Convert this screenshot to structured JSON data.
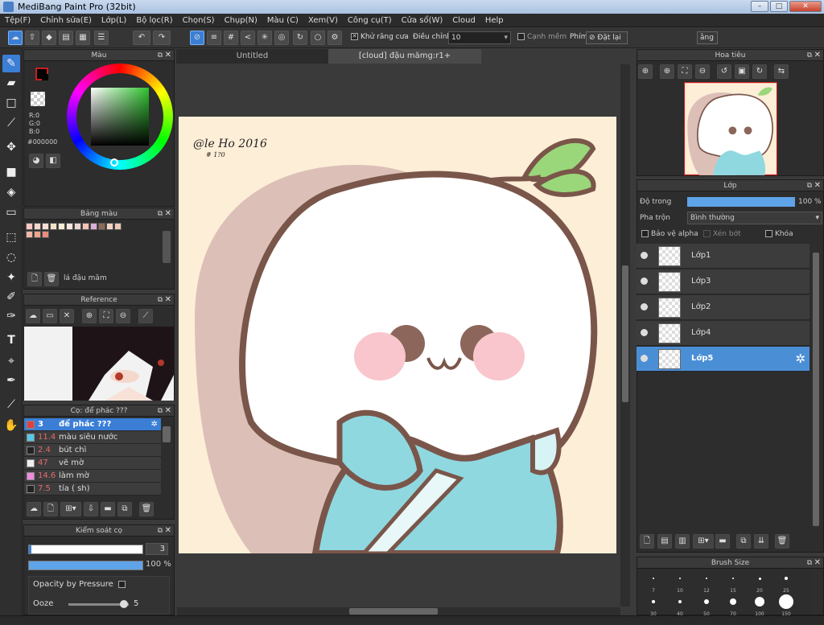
{
  "window": {
    "title": "MediBang Paint Pro (32bit)",
    "min": "–",
    "max": "□",
    "close": "✕"
  },
  "menu": [
    "Tệp(F)",
    "Chỉnh sửa(E)",
    "Lớp(L)",
    "Bộ lọc(R)",
    "Chọn(S)",
    "Chụp(N)",
    "Màu (C)",
    "Xem(V)",
    "Công cụ(T)",
    "Cửa sổ(W)",
    "Cloud",
    "Help"
  ],
  "toolbar": {
    "antialias": "Khử răng cưa",
    "adjust_label": "Điều chỉnh",
    "adjust_value": "10",
    "edge": "Cạnh mềm",
    "key_label": "Phím",
    "reset": "Đặt lại",
    "extra": "ằng"
  },
  "color_panel": {
    "title": "Màu",
    "r": "R:0",
    "g": "G:0",
    "b": "B:0",
    "hex": "#000000",
    "fg": "#000000",
    "accent": "#c81e1e"
  },
  "palette": {
    "title": "Bảng màu",
    "name": "lá đậu măm",
    "colors": [
      "#f7c9c2",
      "#f6d6cf",
      "#f7e0d6",
      "#f5e3c8",
      "#f8eed8",
      "#f9e8dd",
      "#e9d7d0",
      "#f3c3b4",
      "#d9b0d6",
      "#8b6b58",
      "#f3d4c4",
      "#efc7b6",
      "#f2b6a8",
      "#f0a38e",
      "#e88c7c"
    ]
  },
  "reference": {
    "title": "Reference"
  },
  "brush": {
    "title": "Cọ: để phác ???",
    "items": [
      {
        "size": "3",
        "name": "để phác ???",
        "color": "#e04040"
      },
      {
        "size": "11.4",
        "name": "màu siêu nước",
        "color": "#58c8e8"
      },
      {
        "size": "2.4",
        "name": "bút chì",
        "color": "#222222"
      },
      {
        "size": "47",
        "name": "vẽ mờ",
        "color": "#eeeeee"
      },
      {
        "size": "14.6",
        "name": "làm mờ",
        "color": "#f08ae0"
      },
      {
        "size": "7.5",
        "name": "tía ( sh)",
        "color": "#222222"
      }
    ]
  },
  "brush_control": {
    "title": "Kiểm soát cọ",
    "size_value": "3",
    "opacity_value": "100 %",
    "opacity_pressure": "Opacity by Pressure",
    "ooze_label": "Ooze",
    "ooze_value": "5"
  },
  "canvas": {
    "tabs": [
      "Untitled",
      "[cloud] đậu mămg:r1+"
    ],
    "signature": "@le Ho 2016",
    "sig_num": "# 1?0"
  },
  "navigator": {
    "title": "Hoa tiêu"
  },
  "layers": {
    "title": "Lớp",
    "opacity_label": "Độ trong",
    "opacity_value": "100 %",
    "opacity": 1.0,
    "blend_label": "Pha trộn",
    "blend_value": "Bình thường",
    "protect_alpha": "Bảo vệ alpha",
    "clipping": "Xén bớt",
    "lock": "Khóa",
    "items": [
      "Lớp1",
      "Lớp3",
      "Lớp2",
      "Lớp4",
      "Lớp5"
    ]
  },
  "brush_size": {
    "title": "Brush Size",
    "row1": [
      "7",
      "10",
      "12",
      "15",
      "20",
      "25"
    ],
    "row2": [
      "30",
      "40",
      "50",
      "70",
      "100",
      "150"
    ]
  }
}
